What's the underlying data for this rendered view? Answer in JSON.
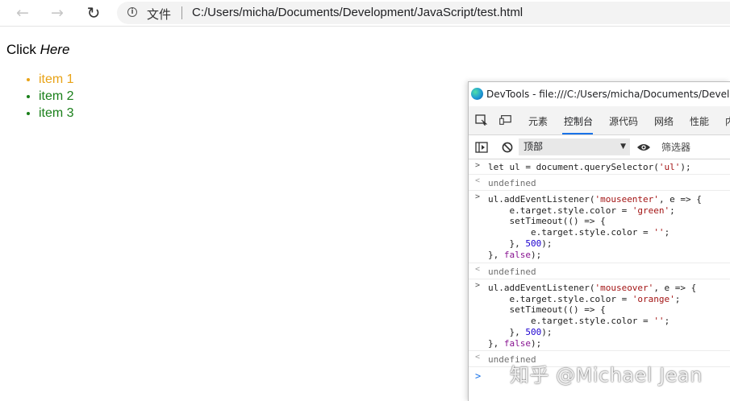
{
  "browser": {
    "back_icon": "←",
    "forward_icon": "→",
    "reload_icon": "↻",
    "info_icon": "i",
    "scheme_label": "文件",
    "url": "C:/Users/micha/Documents/Development/JavaScript/test.html"
  },
  "page": {
    "click_text": "Click ",
    "here_text": "Here",
    "items": [
      {
        "label": "item 1",
        "color": "#e8a317"
      },
      {
        "label": "item 2",
        "color": "#1a7f1a"
      },
      {
        "label": "item 3",
        "color": "#1a7f1a"
      }
    ]
  },
  "devtools": {
    "title": "DevTools - file:///C:/Users/micha/Documents/Development/JavaScript/test.html",
    "tabs": [
      "元素",
      "控制台",
      "源代码",
      "网络",
      "性能",
      "内"
    ],
    "active_tab": "控制台",
    "context": "顶部",
    "filter_placeholder": "筛选器",
    "console": [
      {
        "kind": "input",
        "prompt": ">",
        "code": "let ul = document.querySelector('ul');"
      },
      {
        "kind": "result",
        "prompt": "<",
        "code": "undefined"
      },
      {
        "kind": "input",
        "prompt": ">",
        "code": "ul.addEventListener('mouseenter', e => {\n    e.target.style.color = 'green';\n    setTimeout(() => {\n        e.target.style.color = '';\n    }, 500);\n}, false);"
      },
      {
        "kind": "result",
        "prompt": "<",
        "code": "undefined"
      },
      {
        "kind": "input",
        "prompt": ">",
        "code": "ul.addEventListener('mouseover', e => {\n    e.target.style.color = 'orange';\n    setTimeout(() => {\n        e.target.style.color = '';\n    }, 500);\n}, false);"
      },
      {
        "kind": "result",
        "prompt": "<",
        "code": "undefined"
      }
    ],
    "input_prompt": ">"
  },
  "watermark": "知乎 @Michael Jean"
}
